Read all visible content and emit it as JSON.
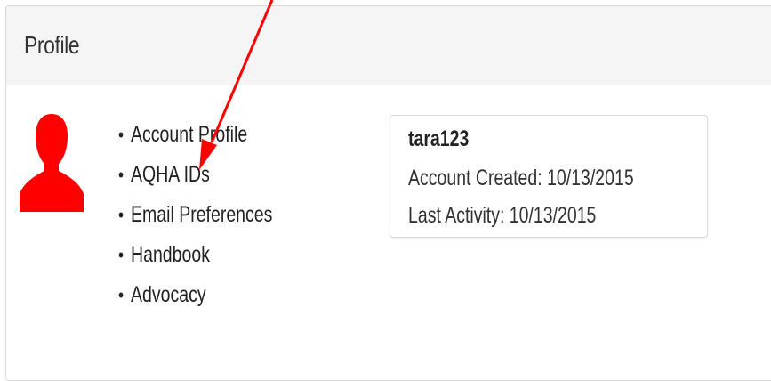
{
  "panel": {
    "title": "Profile"
  },
  "avatar": {
    "icon": "user-silhouette-icon",
    "color": "#ff0000"
  },
  "links": [
    {
      "label": "Account Profile"
    },
    {
      "label": "AQHA IDs"
    },
    {
      "label": "Email Preferences"
    },
    {
      "label": "Handbook"
    },
    {
      "label": "Advocacy"
    }
  ],
  "account": {
    "username": "tara123",
    "created": "Account Created: 10/13/2015",
    "last_activity": "Last Activity: 10/13/2015"
  },
  "annotation": {
    "icon": "red-arrow-icon",
    "color": "#ff0000"
  }
}
